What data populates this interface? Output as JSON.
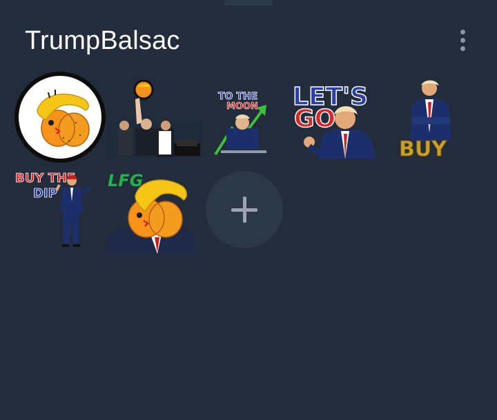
{
  "pack": {
    "title": "TrumpBalsac",
    "menu_icon": "more-vertical-icon"
  },
  "stickers": [
    {
      "id": "balsac-face",
      "icon": "balsac-orange-face-icon"
    },
    {
      "id": "rally-photo",
      "icon": "rally-photo-sticker-icon"
    },
    {
      "id": "to-the-moon",
      "icon": "to-the-moon-sticker-icon",
      "text_line1": "TO THE",
      "text_line2": "MOON"
    },
    {
      "id": "lets-go",
      "icon": "lets-go-sticker-icon",
      "text_line1": "LET'S",
      "text_line2": "GO"
    },
    {
      "id": "buy",
      "icon": "buy-sticker-icon",
      "text": "BUY"
    },
    {
      "id": "buy-the-dip",
      "icon": "buy-the-dip-sticker-icon",
      "text_line1": "BUY THE",
      "text_line2": "DIP"
    },
    {
      "id": "lfg",
      "icon": "lfg-sticker-icon",
      "text": "LFG"
    }
  ],
  "add_button": {
    "icon": "plus-icon"
  },
  "colors": {
    "background": "#222c3a",
    "add_circle": "#2d3847",
    "orange": "#f7931a",
    "hair": "#f5c518",
    "navy": "#1d2f6b",
    "red": "#d62828",
    "green": "#3fbf3f",
    "gold": "#c9a227"
  }
}
